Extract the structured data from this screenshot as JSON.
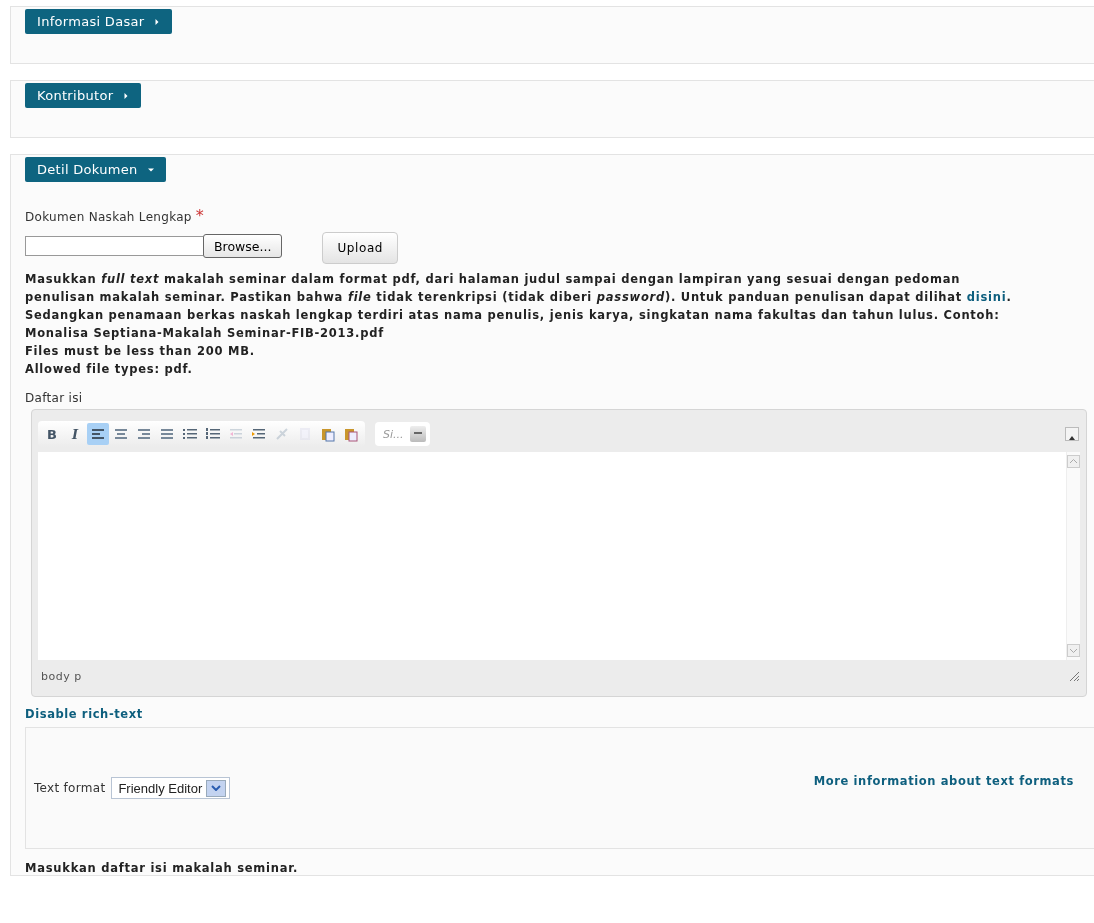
{
  "sections": [
    {
      "label": "Informasi Dasar",
      "expanded": false
    },
    {
      "label": "Kontributor",
      "expanded": false
    },
    {
      "label": "Detil Dokumen",
      "expanded": true
    }
  ],
  "upload": {
    "label": "Dokumen Naskah Lengkap",
    "required_mark": "*",
    "browse": "Browse...",
    "upload": "Upload",
    "description_before": "Masukkan *full text* makalah seminar dalam format pdf, dari halaman judul sampai dengan lampiran yang sesuai dengan pedoman penulisan makalah seminar. Pastikan bahwa *file* tidak terenkripsi (tidak diberi *password*). Untuk panduan penulisan dapat dilihat ",
    "description_link": "disini",
    "description_after": ". Sedangkan penamaan berkas naskah lengkap terdiri atas nama penulis, jenis karya, singkatan nama fakultas dan tahun lulus. Contoh: Monalisa Septiana-Makalah Seminar-FIB-2013.pdf",
    "limits": [
      "Files must be less than 200 MB.",
      "Allowed file types: pdf."
    ]
  },
  "editor": {
    "label": "Daftar isi",
    "toolbar": [
      {
        "label": "B",
        "selected": false,
        "disabled": false
      },
      {
        "label": "I",
        "selected": false,
        "disabled": false
      },
      {
        "selected": true,
        "disabled": false
      },
      {
        "selected": false,
        "disabled": false
      },
      {
        "selected": false,
        "disabled": false
      },
      {
        "selected": false,
        "disabled": false
      },
      {
        "selected": false,
        "disabled": false
      },
      {
        "selected": false,
        "disabled": false
      },
      {
        "selected": false,
        "disabled": true
      },
      {
        "selected": false,
        "disabled": false
      },
      {
        "selected": false,
        "disabled": true
      },
      {
        "selected": false,
        "disabled": true
      },
      {
        "selected": false,
        "disabled": false
      },
      {
        "selected": false,
        "disabled": false
      }
    ],
    "style_dropdown": "Si...",
    "path": "body p",
    "toggle_link": "Disable rich-text",
    "format_label": "Text format",
    "format_value": "Friendly Editor",
    "format_link": "More information about text formats",
    "help": "Masukkan daftar isi makalah seminar."
  }
}
